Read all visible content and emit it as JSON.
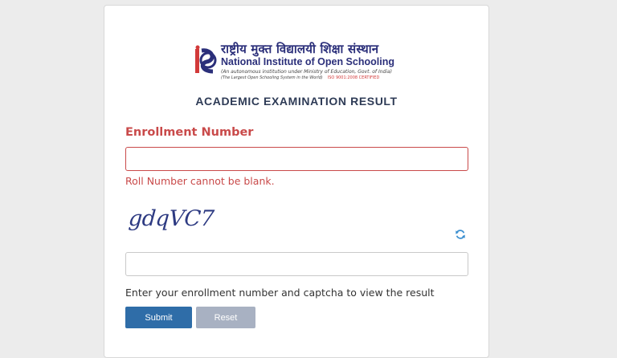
{
  "logo": {
    "hindi_name": "राष्ट्रीय मुक्त विद्यालयी शिक्षा संस्थान",
    "english_name_prefix": "National Institute of ",
    "english_name_highlight": "Open Schooling",
    "subtitle": "(An autonomous institution under Ministry of Education, Govt. of India)",
    "tagline": "(The Largest Open Schooling System in the World)",
    "iso": "ISO 9001:2008 CERTIFIED",
    "icon": "nios-emblem-icon"
  },
  "heading": "ACADEMIC EXAMINATION RESULT",
  "enrollment": {
    "label": "Enrollment Number",
    "value": "",
    "placeholder": "",
    "error": "Roll Number cannot be blank."
  },
  "captcha": {
    "text": "gdqVC7",
    "value": "",
    "placeholder": "",
    "refresh_icon": "refresh-icon"
  },
  "hint": "Enter your enrollment number and captcha to view the result",
  "buttons": {
    "submit": "Submit",
    "reset": "Reset"
  },
  "colors": {
    "label_error": "#c94a4a",
    "heading": "#2e3b56",
    "submit_bg": "#2f6da8",
    "reset_bg": "#a8b1c2",
    "brand": "#2b2f7a"
  }
}
